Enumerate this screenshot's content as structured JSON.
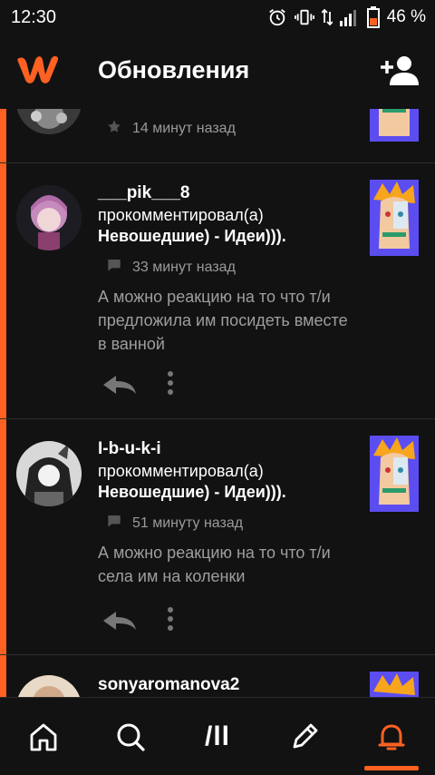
{
  "status": {
    "time": "12:30",
    "battery": "46 %"
  },
  "header": {
    "title": "Обновления"
  },
  "items": [
    {
      "meta": "14 минут назад"
    },
    {
      "username": "___pik___8",
      "action": "прокомментировал(а)",
      "story": "Невошедшие) - Идеи))).",
      "meta": "33 минут назад",
      "comment": "А можно реакцию на то что т/и предложила им посидеть вместе в ванной"
    },
    {
      "username": "I-b-u-k-i",
      "action": "прокомментировал(а)",
      "story": "Невошедшие) - Идеи))).",
      "meta": "51 минуту назад",
      "comment": "А можно реакцию на то что т/и села им на коленки"
    },
    {
      "username": "sonyaromanova2"
    }
  ],
  "colors": {
    "accent": "#ff6122",
    "background": "#121212"
  },
  "nav": {
    "items": [
      {
        "icon": "home-icon"
      },
      {
        "icon": "search-icon"
      },
      {
        "icon": "library-icon",
        "label": "/ll"
      },
      {
        "icon": "pencil-icon"
      },
      {
        "icon": "bell-icon",
        "active": true
      }
    ]
  }
}
